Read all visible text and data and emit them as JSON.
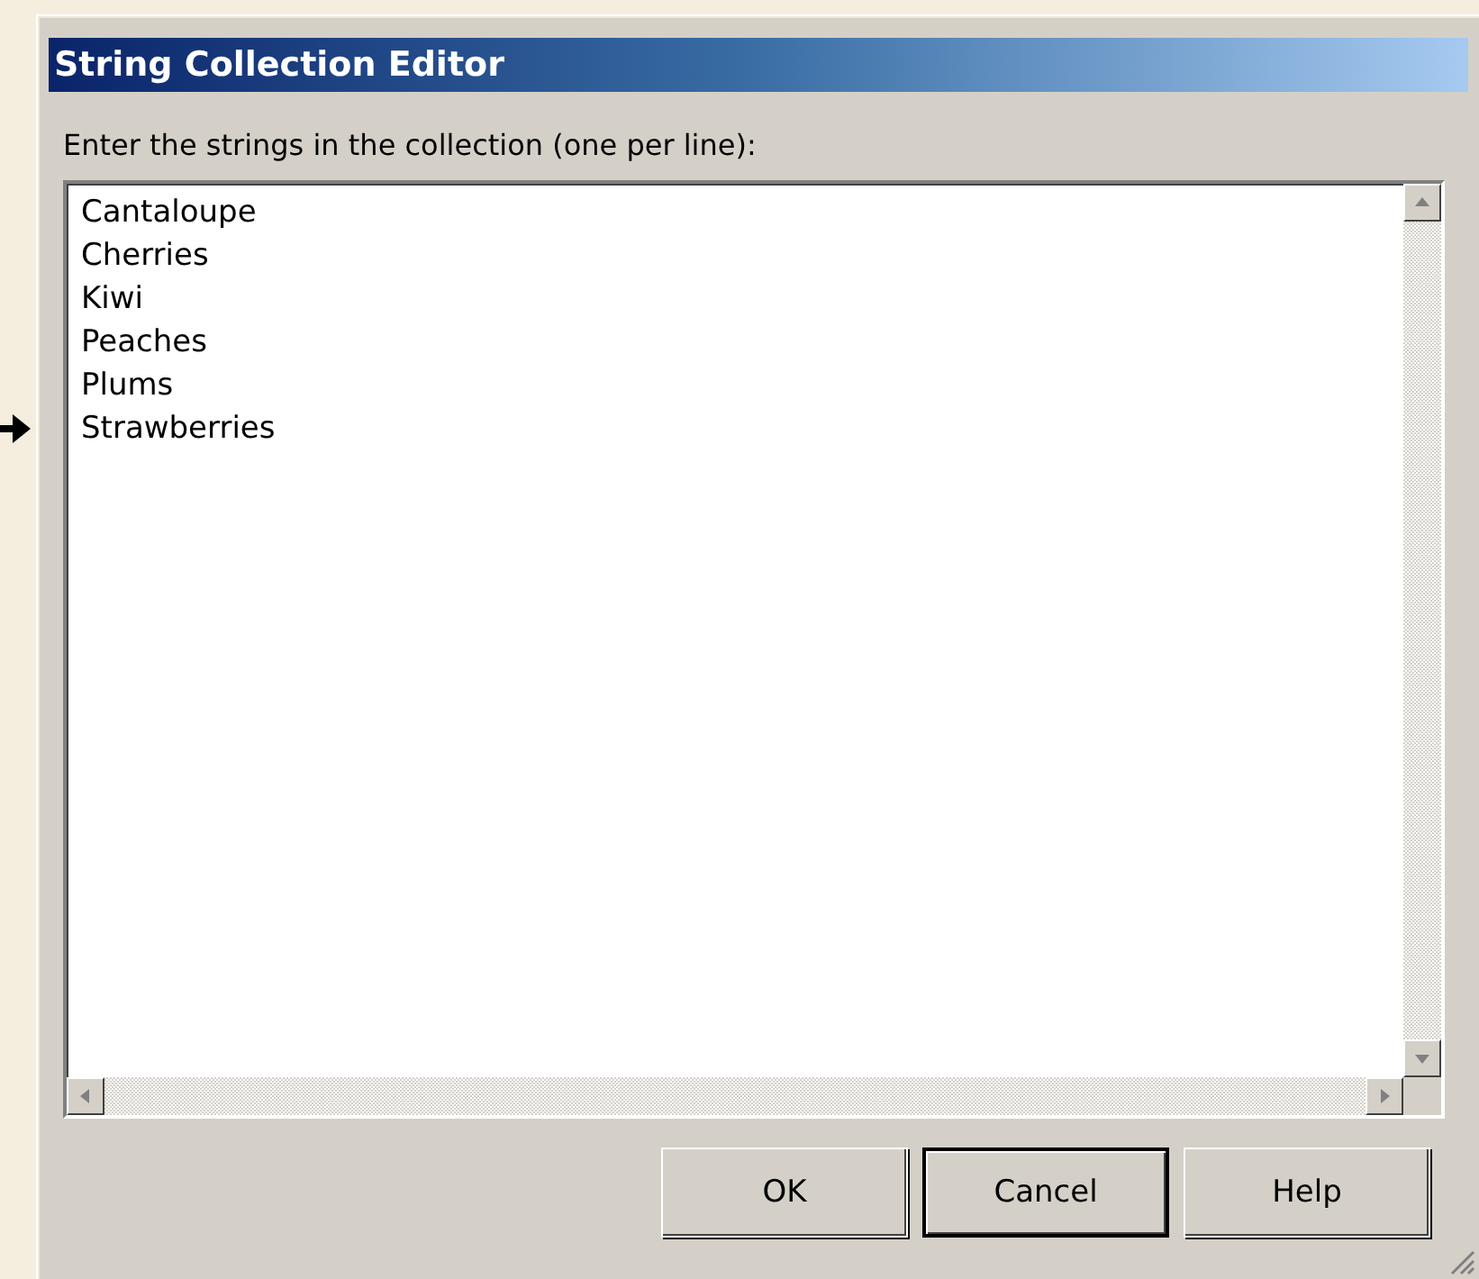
{
  "window": {
    "title": "String Collection Editor"
  },
  "prompt": "Enter the strings in the collection (one per line):",
  "lines": [
    "Cantaloupe",
    "Cherries",
    "Kiwi",
    "Peaches",
    "Plums",
    "Strawberries"
  ],
  "buttons": [
    {
      "label": "OK",
      "default": false
    },
    {
      "label": "Cancel",
      "default": true
    },
    {
      "label": "Help",
      "default": false
    }
  ]
}
